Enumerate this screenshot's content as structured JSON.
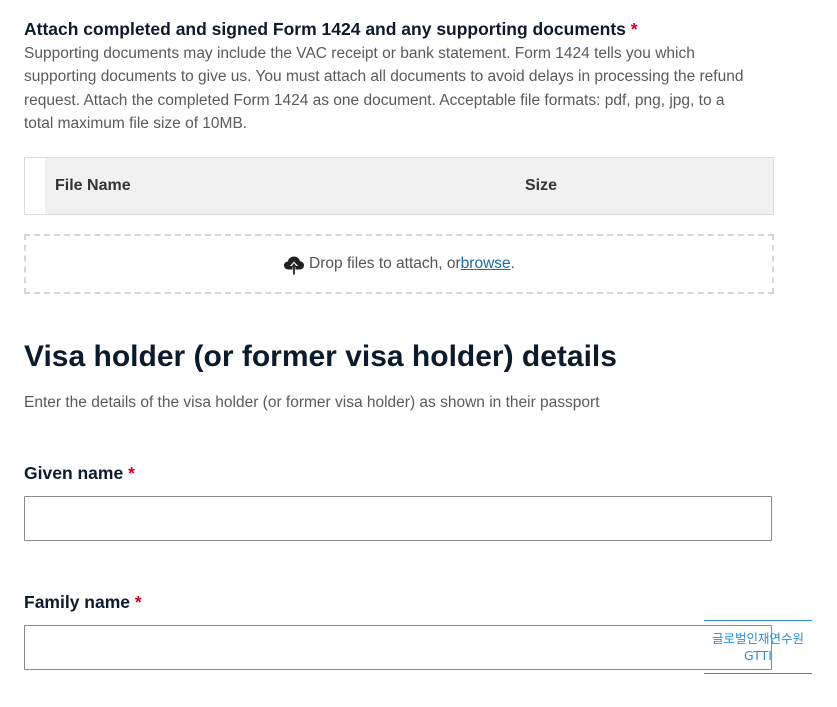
{
  "attachments": {
    "title": "Attach completed and signed Form 1424 and any supporting documents",
    "required_marker": "*",
    "help_text": "Supporting documents may include the VAC receipt or bank statement.  Form 1424 tells you which supporting documents to give us. You must attach all documents to avoid delays in processing the refund request. Attach the completed Form 1424 as one document. Acceptable file formats: pdf, png, jpg, to a total maximum file size of 10MB.",
    "table": {
      "columns": [
        "File Name",
        "Size"
      ]
    },
    "dropzone": {
      "icon": "cloud-upload-icon",
      "text": "Drop files to attach, or ",
      "link_text": "browse",
      "suffix": "."
    }
  },
  "visa_holder": {
    "title": "Visa holder (or former visa holder) details",
    "description": "Enter the details of the visa holder (or former visa holder) as shown in their passport",
    "given_name": {
      "label": "Given name",
      "required_marker": "*",
      "value": ""
    },
    "family_name": {
      "label": "Family name",
      "required_marker": "*",
      "value": ""
    }
  },
  "watermark": {
    "line1": "글로벌인재연수원",
    "line2": "GTTI"
  },
  "colors": {
    "required": "#d0021b",
    "link": "#1a6aa8",
    "heading": "#0b1b2b",
    "watermark": "#2b8ed8"
  }
}
